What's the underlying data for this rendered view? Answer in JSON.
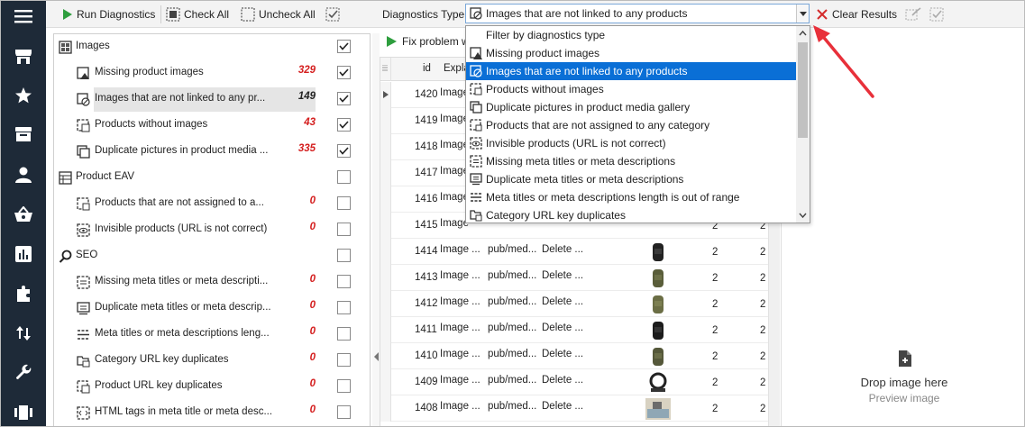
{
  "toolbar": {
    "run": "Run Diagnostics",
    "check_all": "Check All",
    "uncheck_all": "Uncheck All",
    "diag_type_label": "Diagnostics Type",
    "diag_type_value": "Images that are not linked to any products",
    "clear": "Clear Results"
  },
  "dropdown": {
    "items": [
      "Filter by diagnostics type",
      "Missing product images",
      "Images that are not linked to any products",
      "Products without images",
      "Duplicate pictures in product media gallery",
      "Products that are not assigned to any category",
      "Invisible products (URL is not correct)",
      "Missing meta titles or meta descriptions",
      "Duplicate meta titles or meta descriptions",
      "Meta titles or meta descriptions length is out of range",
      "Category URL key duplicates"
    ],
    "selected_index": 2
  },
  "tree": {
    "groups": [
      {
        "label": "Images",
        "checked": true
      },
      {
        "label": "Product  EAV",
        "checked": false
      },
      {
        "label": "SEO",
        "checked": false
      }
    ],
    "items": [
      {
        "label": "Missing product images",
        "count": "329",
        "checked": true
      },
      {
        "label": "Images that are not linked to any pr...",
        "count": "149",
        "checked": true
      },
      {
        "label": "Products without images",
        "count": "43",
        "checked": true
      },
      {
        "label": "Duplicate pictures in product media ...",
        "count": "335",
        "checked": true
      },
      {
        "label": "Products that are not assigned to a...",
        "count": "0",
        "checked": false
      },
      {
        "label": "Invisible products (URL is not correct)",
        "count": "0",
        "checked": false
      },
      {
        "label": "Missing meta titles or meta descripti...",
        "count": "0",
        "checked": false
      },
      {
        "label": "Duplicate meta titles or meta descrip...",
        "count": "0",
        "checked": false
      },
      {
        "label": "Meta titles or meta descriptions leng...",
        "count": "0",
        "checked": false
      },
      {
        "label": "Category URL key duplicates",
        "count": "0",
        "checked": false
      },
      {
        "label": "Product URL key duplicates",
        "count": "0",
        "checked": false
      },
      {
        "label": "HTML tags in meta title or meta desc...",
        "count": "0",
        "checked": false
      }
    ]
  },
  "fix_bar": {
    "label": "Fix problem w"
  },
  "grid": {
    "headers": {
      "id": "id",
      "explanation": "Expla"
    },
    "rows": [
      {
        "id": "1420",
        "expl": "Image",
        "path": "",
        "action": "",
        "q1": "",
        "q2": ""
      },
      {
        "id": "1419",
        "expl": "Image",
        "path": "",
        "action": "",
        "q1": "",
        "q2": ""
      },
      {
        "id": "1418",
        "expl": "Image",
        "path": "",
        "action": "",
        "q1": "",
        "q2": ""
      },
      {
        "id": "1417",
        "expl": "Image",
        "path": "",
        "action": "",
        "q1": "",
        "q2": ""
      },
      {
        "id": "1416",
        "expl": "Image",
        "path": "",
        "action": "",
        "q1": "",
        "q2": ""
      },
      {
        "id": "1415",
        "expl": "Image",
        "path": "",
        "action": "",
        "q1": "2",
        "q2": "2"
      },
      {
        "id": "1414",
        "expl": "Image ...",
        "path": "pub/med...",
        "action": "Delete ...",
        "q1": "2",
        "q2": "2"
      },
      {
        "id": "1413",
        "expl": "Image ...",
        "path": "pub/med...",
        "action": "Delete ...",
        "q1": "2",
        "q2": "2"
      },
      {
        "id": "1412",
        "expl": "Image ...",
        "path": "pub/med...",
        "action": "Delete ...",
        "q1": "2",
        "q2": "2"
      },
      {
        "id": "1411",
        "expl": "Image ...",
        "path": "pub/med...",
        "action": "Delete ...",
        "q1": "2",
        "q2": "2"
      },
      {
        "id": "1410",
        "expl": "Image ...",
        "path": "pub/med...",
        "action": "Delete ...",
        "q1": "2",
        "q2": "2"
      },
      {
        "id": "1409",
        "expl": "Image ...",
        "path": "pub/med...",
        "action": "Delete ...",
        "q1": "2",
        "q2": "2"
      },
      {
        "id": "1408",
        "expl": "Image ...",
        "path": "pub/med...",
        "action": "Delete ...",
        "q1": "2",
        "q2": "2"
      }
    ]
  },
  "preview": {
    "drop": "Drop image here",
    "sub": "Preview image"
  },
  "colors": {
    "rail": "#1e2a38",
    "accent": "#0a6fd6",
    "count_red": "#d41e1e",
    "run_green": "#2e9e3e",
    "arrow": "#e8303a"
  }
}
